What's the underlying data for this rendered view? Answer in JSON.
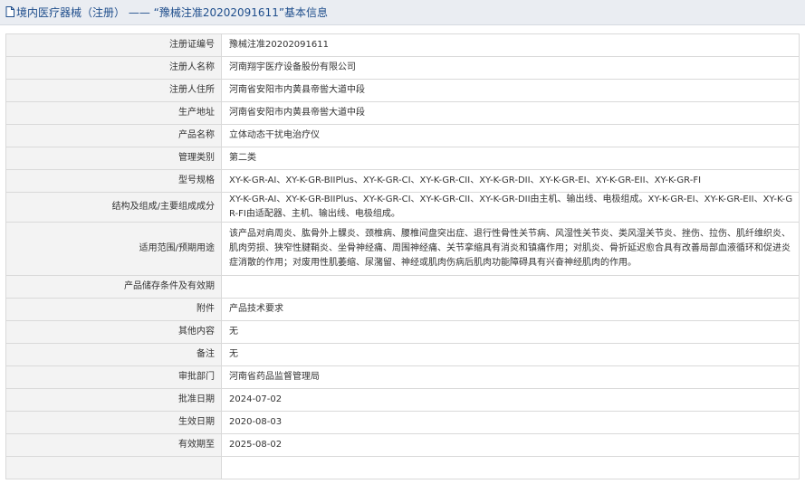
{
  "header": {
    "title": "境内医疗器械（注册） —— “豫械注准20202091611”基本信息"
  },
  "rows": [
    {
      "label": "注册证编号",
      "value": "豫械注准20202091611"
    },
    {
      "label": "注册人名称",
      "value": "河南翔宇医疗设备股份有限公司"
    },
    {
      "label": "注册人住所",
      "value": "河南省安阳市内黄县帝喾大道中段"
    },
    {
      "label": "生产地址",
      "value": "河南省安阳市内黄县帝喾大道中段"
    },
    {
      "label": "产品名称",
      "value": "立体动态干扰电治疗仪"
    },
    {
      "label": "管理类别",
      "value": "第二类"
    },
    {
      "label": "型号规格",
      "value": "XY-K-GR-AI、XY-K-GR-BIIPlus、XY-K-GR-CI、XY-K-GR-CII、XY-K-GR-DII、XY-K-GR-EI、XY-K-GR-EII、XY-K-GR-FI"
    },
    {
      "label": "结构及组成/主要组成成分",
      "value": "XY-K-GR-AI、XY-K-GR-BIIPlus、XY-K-GR-CI、XY-K-GR-CII、XY-K-GR-DII由主机、输出线、电极组成。XY-K-GR-EI、XY-K-GR-EII、XY-K-GR-FI由适配器、主机、输出线、电极组成。"
    },
    {
      "label": "适用范围/预期用途",
      "value": "该产品对肩周炎、肱骨外上髁炎、颈椎病、腰椎间盘突出症、退行性骨性关节病、风湿性关节炎、类风湿关节炎、挫伤、拉伤、肌纤维织炎、肌肉劳损、狭窄性腱鞘炎、坐骨神经痛、周围神经痛、关节挛缩具有消炎和镇痛作用；对肌炎、骨折延迟愈合具有改善局部血液循环和促进炎症消散的作用；对废用性肌萎缩、尿潴留、神经或肌肉伤病后肌肉功能障碍具有兴奋神经肌肉的作用。"
    },
    {
      "label": "产品储存条件及有效期",
      "value": ""
    },
    {
      "label": "附件",
      "value": "产品技术要求"
    },
    {
      "label": "其他内容",
      "value": "无"
    },
    {
      "label": "备注",
      "value": "无"
    },
    {
      "label": "审批部门",
      "value": "河南省药品监督管理局"
    },
    {
      "label": "批准日期",
      "value": "2024-07-02"
    },
    {
      "label": "生效日期",
      "value": "2020-08-03"
    },
    {
      "label": "有效期至",
      "value": "2025-08-02"
    },
    {
      "label": "",
      "value": ""
    }
  ]
}
